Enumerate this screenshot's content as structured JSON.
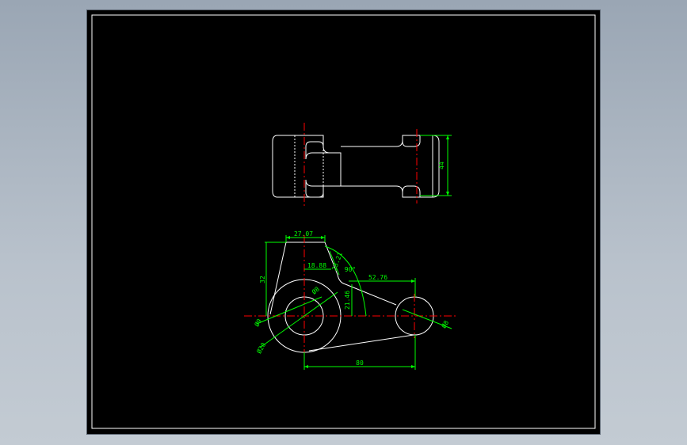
{
  "colors": {
    "background": "#000000",
    "outline": "#ffffff",
    "centerline": "#ff0000",
    "dimension": "#00ff00",
    "page": "#a9b4c0"
  },
  "dimensions": {
    "overall_height_top": "44",
    "top_width": "27.07",
    "offset_width": "18.88",
    "angled_length": "23.21",
    "angle": "90°",
    "arm_length": "52.76",
    "arm_height": "21.46",
    "left_height": "32",
    "hole_diameter": "Ø8",
    "boss_diameter": "Ø9",
    "outer_diameter": "Ø20",
    "link_diameter": "Ø8",
    "center_distance": "80"
  }
}
